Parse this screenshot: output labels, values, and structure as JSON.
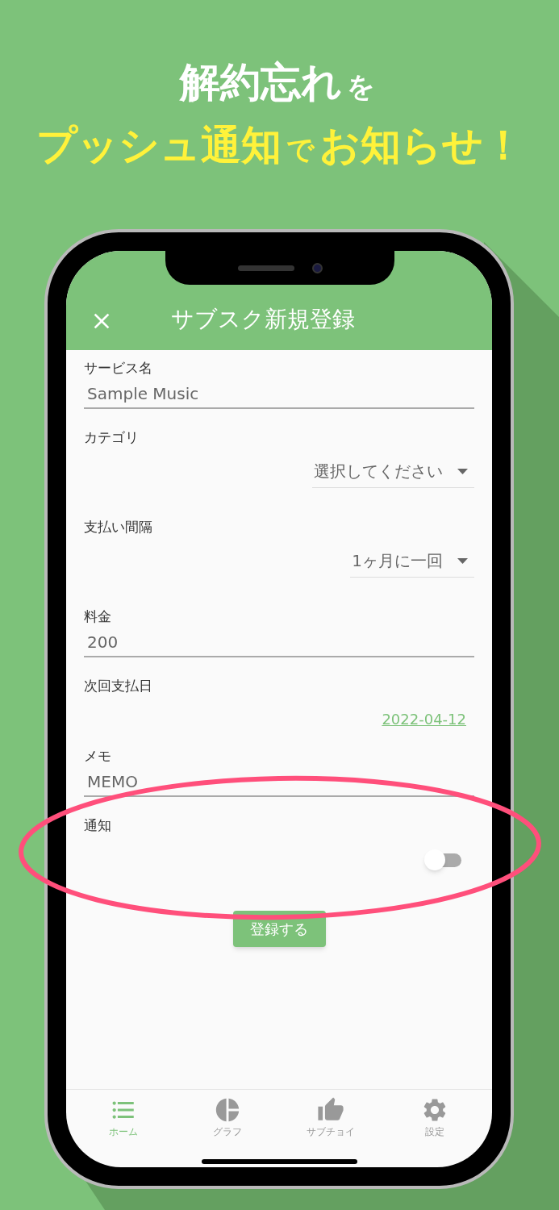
{
  "headline": [
    {
      "parts": [
        {
          "text": "解約忘れ",
          "kind": "large"
        },
        {
          "text": "を",
          "kind": "small"
        }
      ],
      "color": "#ffffff"
    },
    {
      "parts": [
        {
          "text": "プッシュ通知",
          "kind": "large"
        },
        {
          "text": "で",
          "kind": "small"
        },
        {
          "text": "お知らせ！",
          "kind": "large"
        }
      ],
      "color": "#fff23a"
    }
  ],
  "app_bar": {
    "title": "サブスク新規登録"
  },
  "fields": [
    {
      "kind": "text",
      "label": "サービス名",
      "value": "Sample Music"
    },
    {
      "kind": "dropdown",
      "label": "カテゴリ",
      "value": "選択してください"
    },
    {
      "kind": "dropdown",
      "label": "支払い間隔",
      "value": "1ヶ月に一回"
    },
    {
      "kind": "text",
      "label": "料金",
      "value": "200"
    },
    {
      "kind": "date",
      "label": "次回支払日",
      "value": "2022-04-12"
    },
    {
      "kind": "text",
      "label": "メモ",
      "value": "MEMO"
    },
    {
      "kind": "switch",
      "label": "通知",
      "on": false
    }
  ],
  "submit_button": "登録する",
  "nav_items": [
    {
      "kind": "list",
      "label": "ホーム",
      "selected": true
    },
    {
      "kind": "chart",
      "label": "グラフ",
      "selected": false
    },
    {
      "kind": "thumb",
      "label": "サブチョイ",
      "selected": false
    },
    {
      "kind": "gear",
      "label": "設定",
      "selected": false
    }
  ]
}
